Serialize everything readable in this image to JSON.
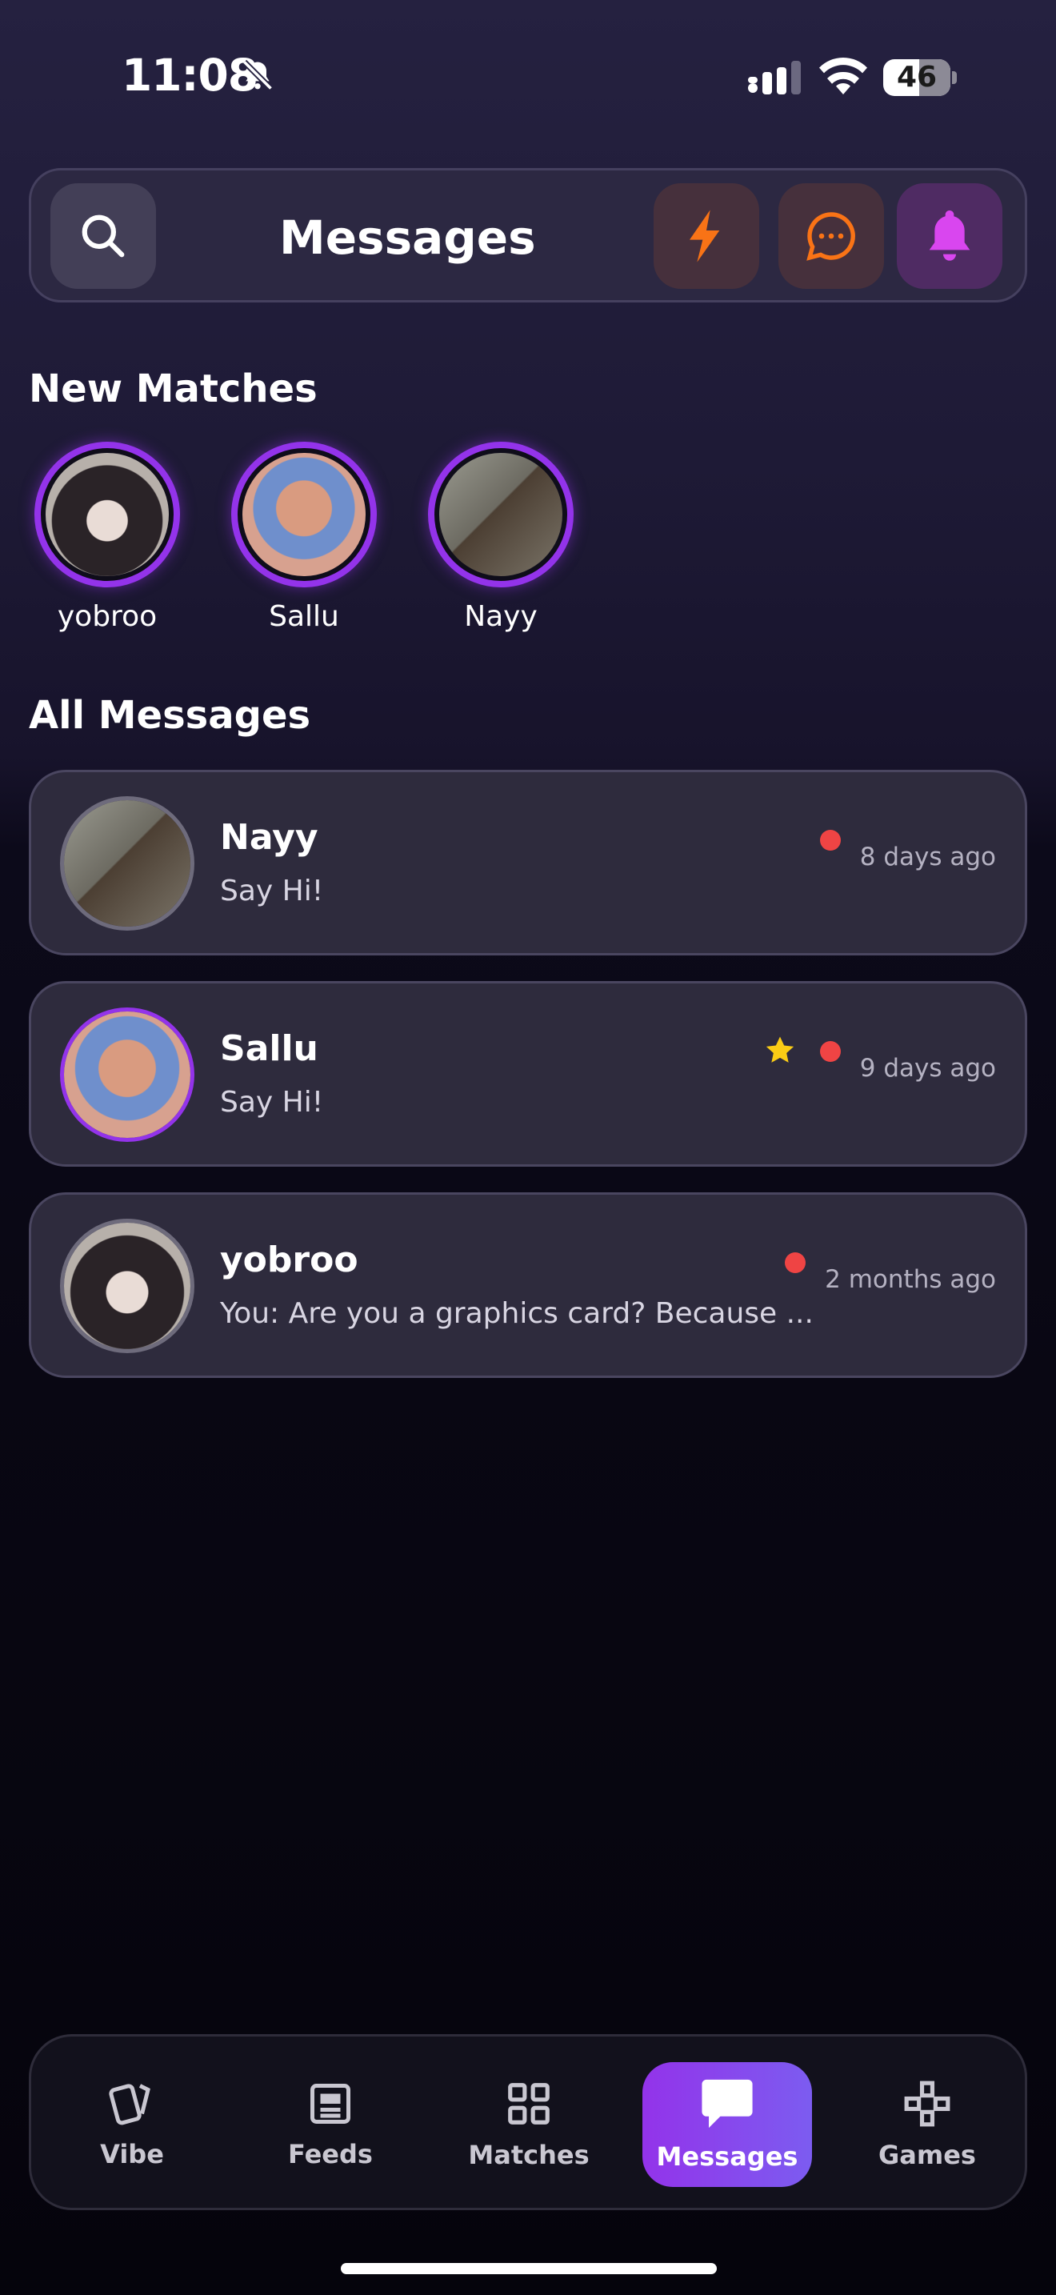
{
  "status_bar": {
    "time": "11:08",
    "battery": "46"
  },
  "header": {
    "title": "Messages"
  },
  "new_matches": {
    "title": "New Matches",
    "items": [
      {
        "name": "yobroo"
      },
      {
        "name": "Sallu"
      },
      {
        "name": "Nayy"
      }
    ]
  },
  "all_messages": {
    "title": "All Messages",
    "items": [
      {
        "name": "Nayy",
        "preview": "Say Hi!",
        "time": "8 days ago",
        "unread": true,
        "starred": false
      },
      {
        "name": "Sallu",
        "preview": "Say Hi!",
        "time": "9 days ago",
        "unread": true,
        "starred": true
      },
      {
        "name": "yobroo",
        "preview": "You: Are you a graphics card? Because ...",
        "time": "2 months ago",
        "unread": true,
        "starred": false
      }
    ]
  },
  "nav": {
    "items": [
      {
        "label": "Vibe",
        "icon": "cards-icon"
      },
      {
        "label": "Feeds",
        "icon": "feed-icon"
      },
      {
        "label": "Matches",
        "icon": "grid-icon"
      },
      {
        "label": "Messages",
        "icon": "chat-icon",
        "active": true
      },
      {
        "label": "Games",
        "icon": "gamepad-icon"
      }
    ]
  },
  "colors": {
    "accent": "#9333ea",
    "unread_dot": "#ef4444",
    "star": "#facc15",
    "bolt": "#f97316"
  }
}
